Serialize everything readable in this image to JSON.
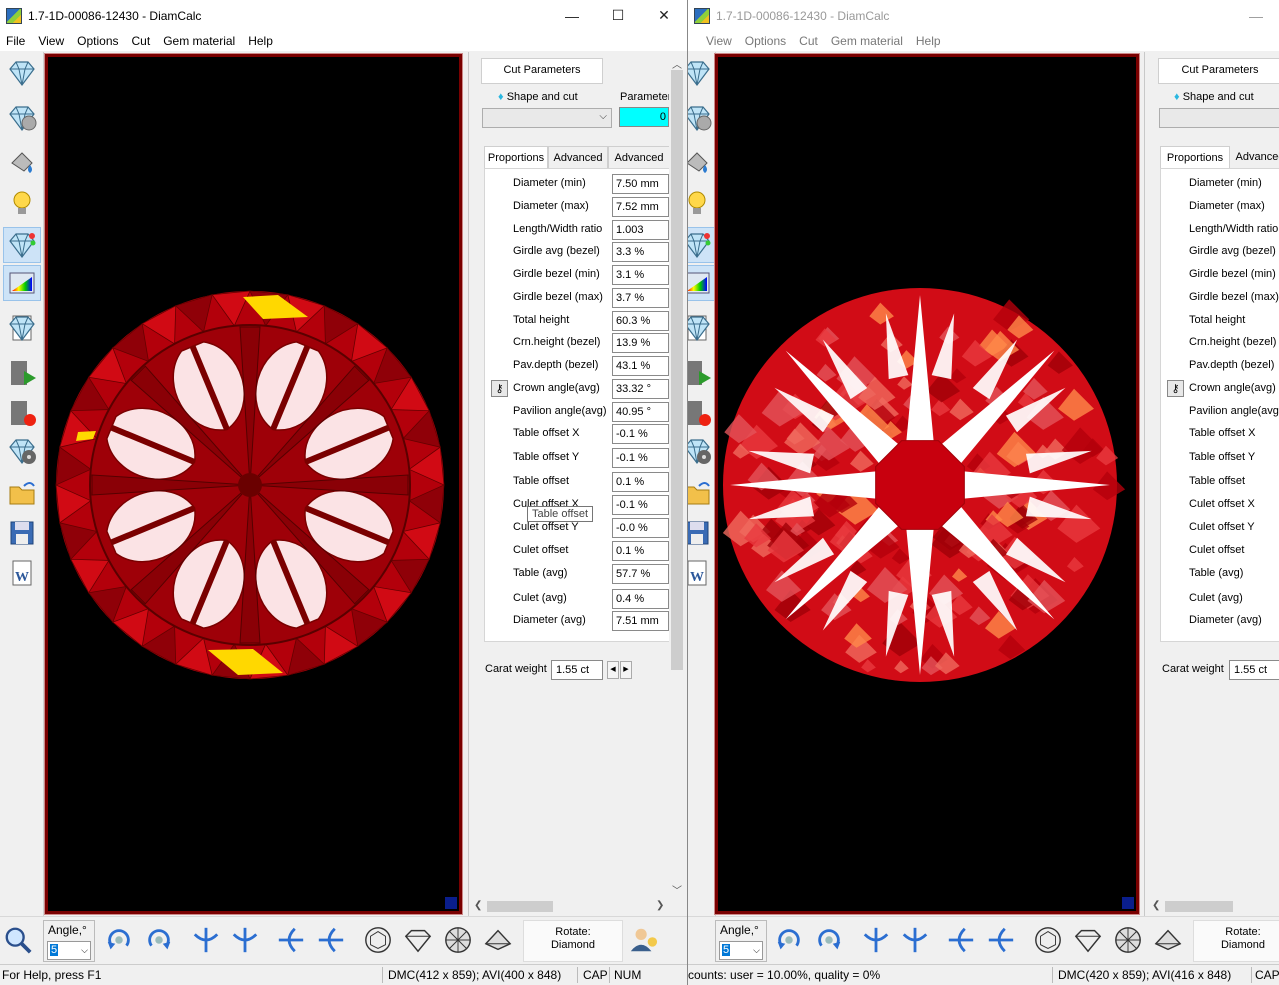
{
  "window_main": {
    "title": "1.7-1D-00086-12430 - DiamCalc",
    "menu": [
      "File",
      "View",
      "Options",
      "Cut",
      "Gem material",
      "Help"
    ],
    "window_buttons": {
      "minimize": "—",
      "maximize": "☐",
      "close": "✕"
    },
    "panel": {
      "tab_label": "Cut Parameters",
      "shape_label": "Shape and cut",
      "parameter_label": "Parameter",
      "parameter_value": "0",
      "subtabs": [
        "Proportions",
        "Advanced",
        "Advanced"
      ],
      "rows": [
        {
          "label": "Diameter (min)",
          "value": "7.50 mm"
        },
        {
          "label": "Diameter (max)",
          "value": "7.52 mm"
        },
        {
          "label": "Length/Width ratio",
          "value": "1.003"
        },
        {
          "label": "Girdle avg (bezel)",
          "value": "3.3 %"
        },
        {
          "label": "Girdle bezel (min)",
          "value": "3.1 %"
        },
        {
          "label": "Girdle bezel (max)",
          "value": "3.7 %"
        },
        {
          "label": "Total height",
          "value": "60.3 %"
        },
        {
          "label": "Crn.height (bezel)",
          "value": "13.9 %"
        },
        {
          "label": "Pav.depth (bezel)",
          "value": "43.1 %"
        },
        {
          "label": "Crown angle(avg)",
          "value": "33.32 °"
        },
        {
          "label": "Pavilion angle(avg)",
          "value": "40.95 °"
        },
        {
          "label": "Table offset X",
          "value": "-0.1 %"
        },
        {
          "label": "Table offset Y",
          "value": "-0.1 %"
        },
        {
          "label": "Table offset",
          "value": "0.1 %"
        },
        {
          "label": "Culet offset X",
          "value": "-0.1 %"
        },
        {
          "label": "Culet offset Y",
          "value": "-0.0 %"
        },
        {
          "label": "Culet offset",
          "value": "0.1 %"
        },
        {
          "label": "Table (avg)",
          "value": "57.7 %"
        },
        {
          "label": "Culet (avg)",
          "value": "0.4 %"
        },
        {
          "label": "Diameter (avg)",
          "value": "7.51 mm"
        }
      ],
      "tooltip": "Table offset",
      "carat_label": "Carat weight",
      "carat_value": "1.55 ct",
      "lock_icon_glyph": "⚷"
    },
    "bottom": {
      "angle_label": "Angle,°",
      "angle_value": "5",
      "rotate_label": "Rotate:",
      "rotate_value": "Diamond"
    },
    "status": {
      "help": "For Help, press F1",
      "dims": "DMC(412 x 859); AVI(400 x 848)",
      "cap": "CAP",
      "num": "NUM"
    }
  },
  "window_second": {
    "title": "1.7-1D-00086-12430 - DiamCalc",
    "menu": [
      "View",
      "Options",
      "Cut",
      "Gem material",
      "Help"
    ],
    "window_buttons": {
      "minimize": "—"
    },
    "panel": {
      "tab_label": "Cut Parameters",
      "shape_label": "Shape and cut",
      "subtabs": [
        "Proportions",
        "Advanced"
      ],
      "rows": [
        {
          "label": "Diameter (min)"
        },
        {
          "label": "Diameter (max)"
        },
        {
          "label": "Length/Width ratio"
        },
        {
          "label": "Girdle avg (bezel)"
        },
        {
          "label": "Girdle bezel (min)"
        },
        {
          "label": "Girdle bezel (max)"
        },
        {
          "label": "Total height"
        },
        {
          "label": "Crn.height (bezel)"
        },
        {
          "label": "Pav.depth (bezel)"
        },
        {
          "label": "Crown angle(avg)"
        },
        {
          "label": "Pavilion angle(avg)"
        },
        {
          "label": "Table offset X"
        },
        {
          "label": "Table offset Y"
        },
        {
          "label": "Table offset"
        },
        {
          "label": "Culet offset X"
        },
        {
          "label": "Culet offset Y"
        },
        {
          "label": "Culet offset"
        },
        {
          "label": "Table (avg)"
        },
        {
          "label": "Culet (avg)"
        },
        {
          "label": "Diameter (avg)"
        }
      ],
      "carat_label": "Carat weight",
      "carat_value": "1.55 ct"
    },
    "bottom": {
      "angle_label": "Angle,°",
      "angle_value": "5",
      "rotate_label": "Rotate:",
      "rotate_value": "Diamond"
    },
    "status": {
      "counts": "counts: user = 10.00%, quality = 0%",
      "dims": "DMC(420 x 859); AVI(416 x 848)",
      "cap": "CAP"
    }
  },
  "colors": {
    "viewport_border": "#7a0000",
    "gem_red": "#c8000e",
    "accent_cyan": "#00ffff",
    "selected_tool": "#cde3f7"
  }
}
